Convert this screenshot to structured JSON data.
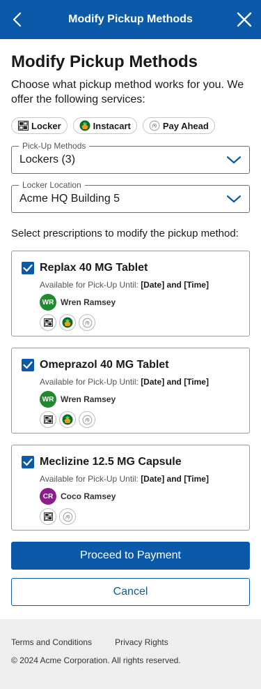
{
  "header": {
    "title": "Modify Pickup Methods",
    "back_icon": "chevron-left-icon",
    "close_icon": "close-icon",
    "color": "#0b5aa9"
  },
  "page": {
    "title": "Modify Pickup Methods",
    "intro": "Choose what pickup method works for you. We offer the following services:"
  },
  "services": [
    {
      "label": "Locker",
      "icon": "locker-icon"
    },
    {
      "label": "Instacart",
      "icon": "instacart-icon"
    },
    {
      "label": "Pay Ahead",
      "icon": "pay-ahead-icon"
    }
  ],
  "pickup_methods": {
    "legend": "Pick-Up Methods",
    "value": "Lockers (3)"
  },
  "locker_location": {
    "legend": "Locker Location",
    "value": "Acme HQ Building 5"
  },
  "select_prompt": "Select prescriptions to modify the pickup method:",
  "prescriptions": [
    {
      "name": "Replax 40 MG Tablet",
      "avail_label": "Available for Pick-Up Until:",
      "avail_value": "[Date] and [Time]",
      "initials": "WR",
      "person": "Wren Ramsey",
      "checked": true,
      "services": [
        "locker-icon",
        "instacart-icon",
        "pay-ahead-icon"
      ]
    },
    {
      "name": "Omeprazol 40 MG Tablet",
      "avail_label": "Available for Pick-Up Until:",
      "avail_value": "[Date] and [Time]",
      "initials": "WR",
      "person": "Wren Ramsey",
      "checked": true,
      "services": [
        "locker-icon",
        "instacart-icon",
        "pay-ahead-icon"
      ]
    },
    {
      "name": "Meclizine 12.5 MG Capsule",
      "avail_label": "Available for Pick-Up Until:",
      "avail_value": "[Date] and [Time]",
      "initials": "CR",
      "person": "Coco Ramsey",
      "checked": true,
      "services": [
        "locker-icon",
        "pay-ahead-icon"
      ]
    }
  ],
  "actions": {
    "proceed": "Proceed to Payment",
    "cancel": "Cancel"
  },
  "footer": {
    "terms": "Terms and Conditions",
    "privacy": "Privacy Rights",
    "copyright": "© 2024 Acme Corporation. All rights reserved."
  }
}
